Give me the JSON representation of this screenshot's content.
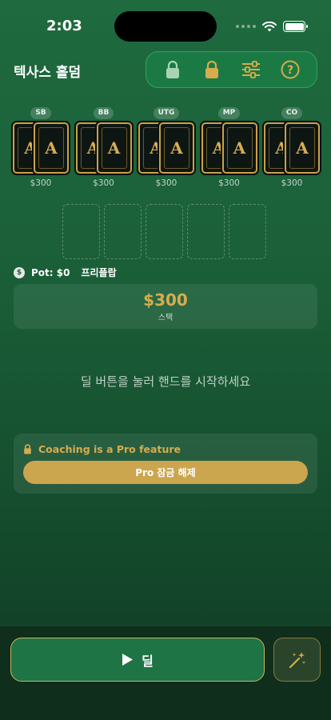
{
  "status_bar": {
    "time": "2:03"
  },
  "header": {
    "title": "텍사스 홀덤",
    "toolbar": {
      "items": [
        {
          "icon": "lock-open-icon",
          "color": "#a8d4b4"
        },
        {
          "icon": "lock-icon",
          "color": "#d7ac4c"
        },
        {
          "icon": "sliders-icon",
          "color": "#d7ac4c"
        },
        {
          "icon": "help-icon",
          "color": "#d7ac4c"
        }
      ]
    }
  },
  "table": {
    "seats": [
      {
        "position": "SB",
        "cards": [
          "A",
          "A"
        ],
        "stack": "$300"
      },
      {
        "position": "BB",
        "cards": [
          "A",
          "A"
        ],
        "stack": "$300"
      },
      {
        "position": "UTG",
        "cards": [
          "A",
          "A"
        ],
        "stack": "$300"
      },
      {
        "position": "MP",
        "cards": [
          "A",
          "A"
        ],
        "stack": "$300"
      },
      {
        "position": "CO",
        "cards": [
          "A",
          "A"
        ],
        "stack": "$300"
      }
    ],
    "board_slots": 5,
    "pot": {
      "coin_symbol": "$",
      "label": "Pot: $0",
      "street": "프리플랍"
    }
  },
  "hero": {
    "stack_amount": "$300",
    "stack_label": "스택"
  },
  "hint": "딜 버튼을 눌러 핸드를 시작하세요",
  "coaching": {
    "message": "Coaching is a Pro feature",
    "unlock_label": "Pro 잠금 해제"
  },
  "actions": {
    "deal_label": "딜"
  },
  "colors": {
    "accent_gold": "#d7ac4c",
    "felt_green": "#1a5e37",
    "button_green": "#1e7444"
  }
}
